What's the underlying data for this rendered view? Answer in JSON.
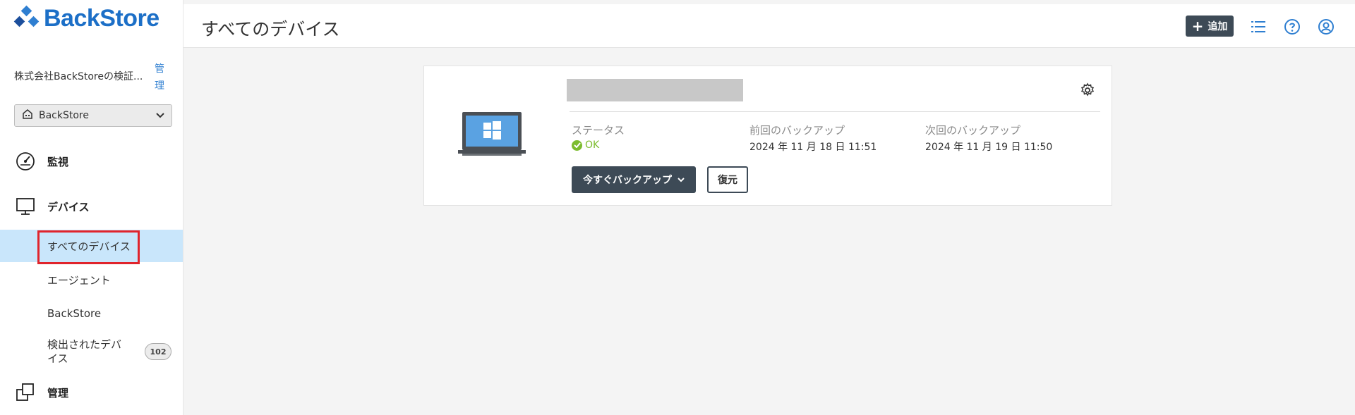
{
  "brand": {
    "name": "BackStore",
    "color": "#1c6fc7"
  },
  "sidebar": {
    "org_name": "株式会社BackStoreの検証...",
    "org_manage_label": "管理",
    "org_select_value": "BackStore",
    "nav": {
      "monitor": "監視",
      "devices": "デバイス",
      "admin": "管理"
    },
    "subitems": [
      {
        "label": "すべてのデバイス",
        "active": true
      },
      {
        "label": "エージェント"
      },
      {
        "label": "BackStore"
      },
      {
        "label": "検出されたデバイス",
        "badge": "102"
      }
    ]
  },
  "header": {
    "title": "すべてのデバイス",
    "add_label": "追加",
    "icons": [
      "list-icon",
      "help-icon",
      "account-icon"
    ]
  },
  "device": {
    "name": "",
    "os_icon": "windows-laptop-icon",
    "status_label": "ステータス",
    "status_value": "OK",
    "last_backup_label": "前回のバックアップ",
    "last_backup_value": "2024 年 11 月 18 日 11:51",
    "next_backup_label": "次回のバックアップ",
    "next_backup_value": "2024 年 11 月 19 日 11:50",
    "backup_now_label": "今すぐバックアップ",
    "restore_label": "復元"
  },
  "colors": {
    "accent": "#3d4a56",
    "ok": "#7cbc2e",
    "active_bg": "#c9e6fb",
    "highlight": "#e0242c"
  }
}
